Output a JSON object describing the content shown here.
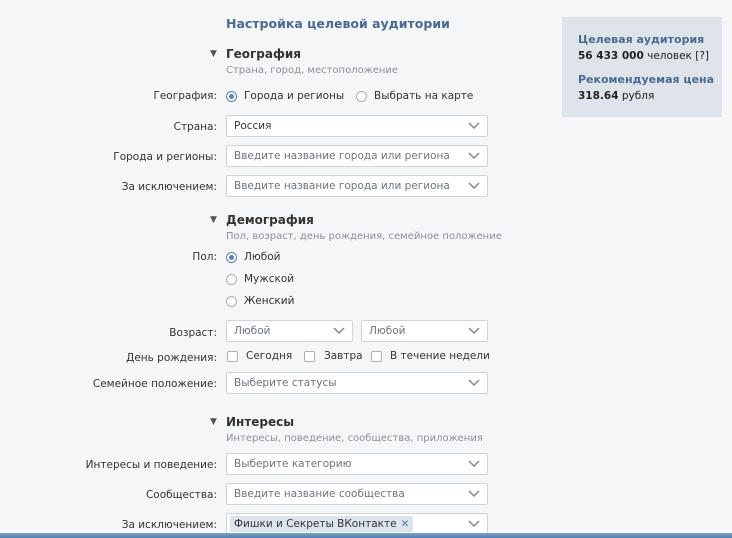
{
  "page_title": "Настройка целевой аудитории",
  "sections": {
    "geo": {
      "title": "География",
      "subtitle": "Страна, город, местоположение"
    },
    "demo": {
      "title": "Демография",
      "subtitle": "Пол, возраст, день рождения, семейное положение"
    },
    "interests": {
      "title": "Интересы",
      "subtitle": "Интересы, поведение, сообщества, приложения"
    }
  },
  "geo": {
    "label": "География:",
    "option_cities": "Города и регионы",
    "option_map": "Выбрать на карте",
    "country_label": "Страна:",
    "country_value": "Россия",
    "cities_label": "Города и регионы:",
    "cities_placeholder": "Введите название города или региона",
    "exclude_label": "За исключением:",
    "exclude_placeholder": "Введите название города или региона"
  },
  "demo": {
    "gender_label": "Пол:",
    "gender_any": "Любой",
    "gender_male": "Мужской",
    "gender_female": "Женский",
    "age_label": "Возраст:",
    "age_from": "Любой",
    "age_to": "Любой",
    "birthday_label": "День рождения:",
    "bd_today": "Сегодня",
    "bd_tomorrow": "Завтра",
    "bd_week": "В течение недели",
    "marital_label": "Семейное положение:",
    "marital_placeholder": "Выберите статусы"
  },
  "interests": {
    "behavior_label": "Интересы и поведение:",
    "behavior_placeholder": "Выберите категорию",
    "communities_label": "Сообщества:",
    "communities_placeholder": "Введите название сообщества",
    "exclude_label": "За исключением:",
    "exclude_tag": "Фишки и Секреты ВКонтакте"
  },
  "sidebar": {
    "audience_title": "Целевая аудитория",
    "audience_count": "56 433 000",
    "audience_unit": "человек [?]",
    "price_title": "Рекомендуемая цена",
    "price_value": "318.64",
    "price_unit": "рубля"
  },
  "colors": {
    "accent": "#5b80ad",
    "heading": "#4a6a8f",
    "sidebar_bg": "#dfe4ea"
  }
}
